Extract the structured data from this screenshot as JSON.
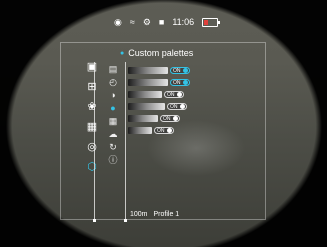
{
  "status": {
    "time": "11:06",
    "icons": [
      "eye-icon",
      "wifi-icon",
      "gear-circle-icon",
      "card-icon"
    ],
    "battery_color": "#e0413c",
    "battery_level": 0.35
  },
  "header": {
    "title": "Custom palettes"
  },
  "left_nav": [
    {
      "name": "picture-in-picture-icon"
    },
    {
      "name": "plus-square-icon"
    },
    {
      "name": "gear-cluster-icon"
    },
    {
      "name": "grid-icon"
    },
    {
      "name": "target-icon"
    },
    {
      "name": "settings-hex-icon",
      "active": true
    }
  ],
  "menu_icons": [
    "calendar-icon",
    "clock-icon",
    "contrast-icon",
    "globe-icon",
    "palette-grid-icon",
    "download-icon",
    "refresh-icon",
    "info-icon"
  ],
  "palette_rows": [
    {
      "toggle": "ON",
      "on": true
    },
    {
      "toggle": "ON",
      "on": true
    },
    {
      "toggle": "ON",
      "on": false
    },
    {
      "toggle": "ON",
      "on": false
    },
    {
      "toggle": "ON",
      "on": false
    },
    {
      "toggle": "ON",
      "on": false
    }
  ],
  "bottom": {
    "distance": "100m",
    "profile": "Profile 1"
  },
  "accent_color": "#34c3e6"
}
